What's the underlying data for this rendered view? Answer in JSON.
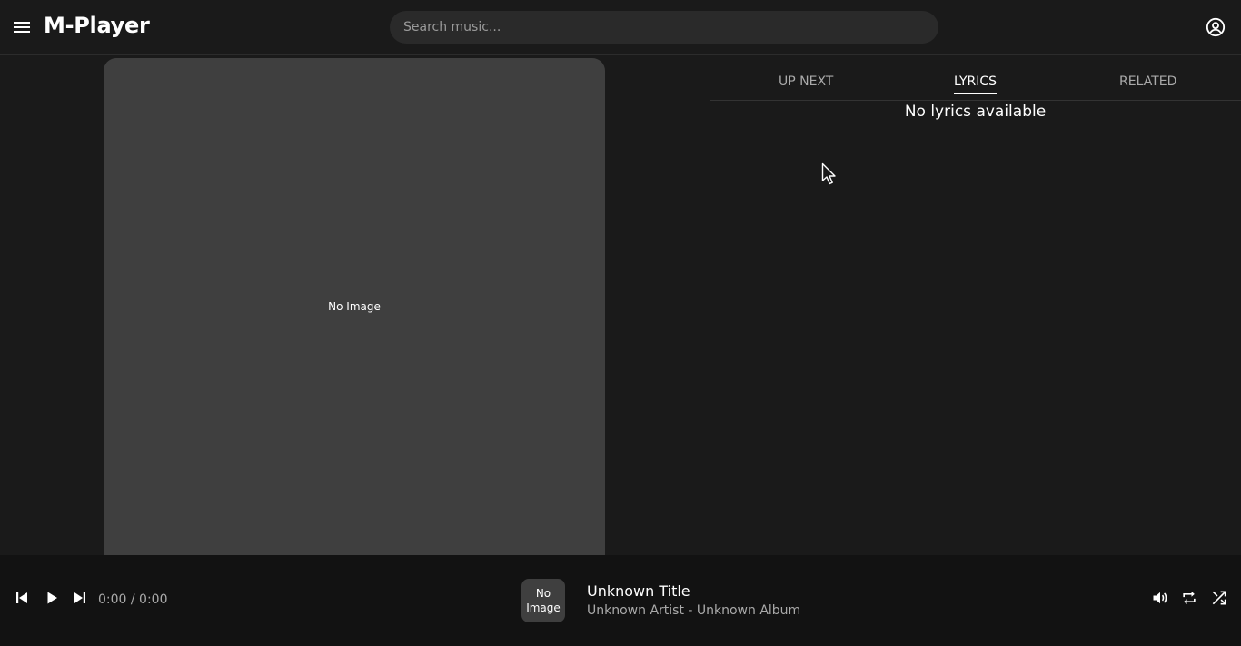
{
  "app": {
    "title": "M-Player"
  },
  "header": {
    "menu_icon": "menu-icon",
    "search_placeholder": "Search music...",
    "account_icon": "account-circle-icon"
  },
  "artwork": {
    "placeholder_text": "No Image"
  },
  "tabs": [
    {
      "label": "UP NEXT",
      "active": false
    },
    {
      "label": "LYRICS",
      "active": true
    },
    {
      "label": "RELATED",
      "active": false
    }
  ],
  "lyrics": {
    "empty_message": "No lyrics available"
  },
  "player": {
    "time": "0:00 / 0:00",
    "thumbnail_text": "No Image",
    "track_title": "Unknown Title",
    "track_subtitle": "Unknown Artist - Unknown Album",
    "icons": [
      "skip-previous-icon",
      "play-icon",
      "skip-next-icon",
      "volume-icon",
      "repeat-icon",
      "shuffle-icon"
    ]
  },
  "colors": {
    "background": "#1a1a1a",
    "player_bar": "#121212",
    "artwork_placeholder": "#3f3f3f",
    "search_field": "#2a2a2a",
    "muted_text": "#aaaaaa"
  }
}
